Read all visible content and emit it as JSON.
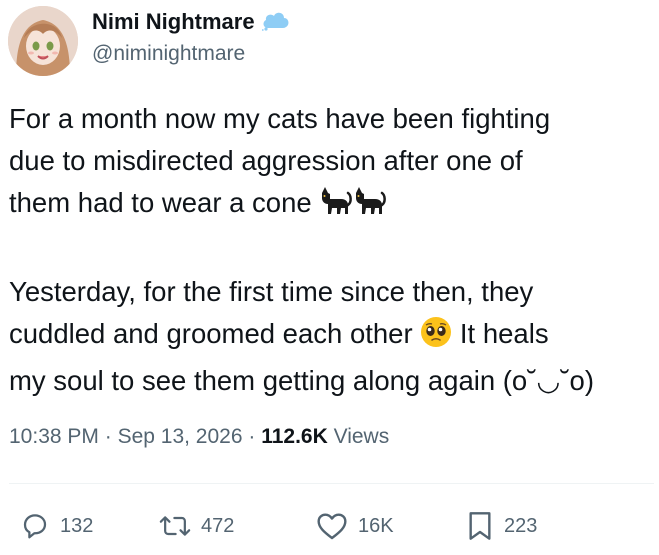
{
  "author": {
    "display_name": "Nimi Nightmare",
    "handle": "@niminightmare",
    "badge_icon": "cloud-icon"
  },
  "tweet": {
    "paragraphs": [
      {
        "lines": [
          "For a month now my cats have been fighting",
          "due to misdirected aggression after one of",
          "them had to wear a cone "
        ],
        "trailing_emoji": "black-cat-emoji"
      },
      {
        "lines": [
          "Yesterday, for the first time since then, they",
          "cuddled and groomed each other ",
          "my soul to see them getting along again (o˘◡˘o)"
        ],
        "line2_after_emoji": " It heals",
        "inline_emoji": "pleading-face-emoji"
      }
    ]
  },
  "meta": {
    "time": "10:38 PM",
    "separator": " · ",
    "date": "Sep 13, 2026",
    "views_count": "112.6K",
    "views_label": " Views"
  },
  "actions": {
    "reply_count": "132",
    "retweet_count": "472",
    "like_count": "16K",
    "bookmark_count": "223"
  },
  "colors": {
    "text_primary": "#0f1419",
    "text_secondary": "#536471",
    "badge_blue": "#8ecdf5",
    "divider": "#eff3f4"
  }
}
